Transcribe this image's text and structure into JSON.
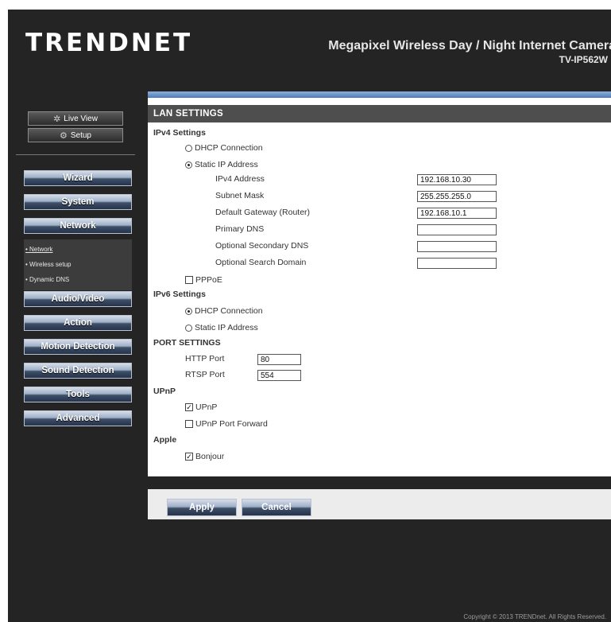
{
  "header": {
    "logo": "TRENDNET",
    "product": "Megapixel Wireless Day / Night Internet Camera",
    "model": "TV-IP562W"
  },
  "sidebar": {
    "live_view": "Live View",
    "setup": "Setup",
    "menu": [
      "Wizard",
      "System",
      "Network",
      "Audio/Video",
      "Action",
      "Motion Detection",
      "Sound Detection",
      "Tools",
      "Advanced"
    ],
    "network_sub": [
      "Network",
      "Wireless setup",
      "Dynamic DNS"
    ]
  },
  "lan": {
    "title": "LAN SETTINGS",
    "ipv4_title": "IPv4 Settings",
    "dhcp": "DHCP Connection",
    "static": "Static IP Address",
    "ipv4_address_label": "IPv4 Address",
    "ipv4_address": "192.168.10.30",
    "subnet_label": "Subnet Mask",
    "subnet": "255.255.255.0",
    "gateway_label": "Default Gateway (Router)",
    "gateway": "192.168.10.1",
    "dns1_label": "Primary DNS",
    "dns1": "",
    "dns2_label": "Optional Secondary DNS",
    "dns2": "",
    "search_label": "Optional Search Domain",
    "search": "",
    "pppoe": "PPPoE",
    "ipv6_title": "IPv6 Settings",
    "ipv6_dhcp": "DHCP Connection",
    "ipv6_static": "Static IP Address"
  },
  "port": {
    "title": "PORT SETTINGS",
    "http_label": "HTTP Port",
    "http": "80",
    "rtsp_label": "RTSP Port",
    "rtsp": "554"
  },
  "upnp": {
    "title": "UPnP",
    "upnp": "UPnP",
    "forward": "UPnP Port Forward"
  },
  "apple": {
    "title": "Apple",
    "bonjour": "Bonjour"
  },
  "actions": {
    "apply": "Apply",
    "cancel": "Cancel"
  },
  "footer": {
    "copyright": "Copyright © 2013 TRENDnet. All Rights Reserved."
  }
}
